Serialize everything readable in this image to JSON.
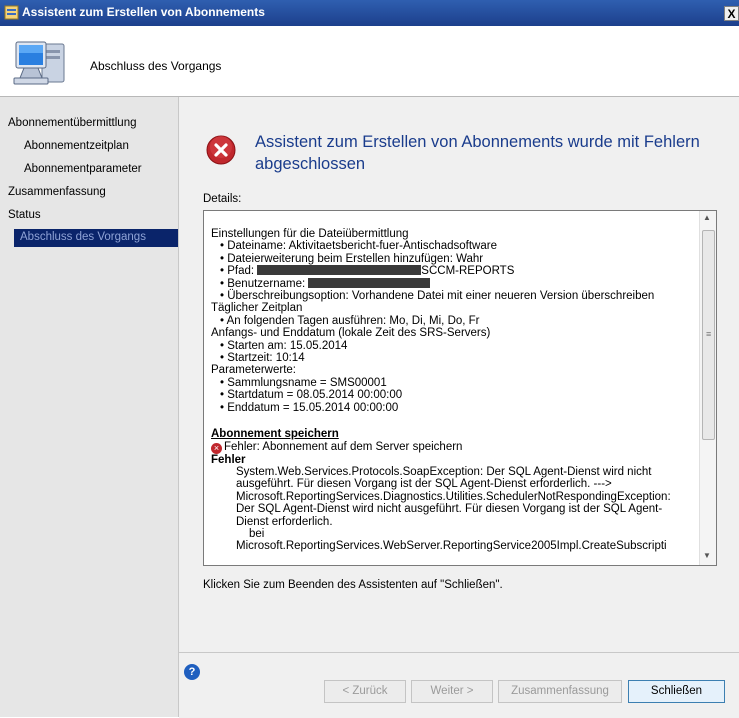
{
  "window": {
    "title": "Assistent zum Erstellen von Abonnements",
    "close_label": "X"
  },
  "header": {
    "title": "Abschluss des Vorgangs",
    "icon": "computer-monitor-icon"
  },
  "sidebar": {
    "items": [
      {
        "label": "Abonnementübermittlung"
      },
      {
        "label": "Abonnementzeitplan"
      },
      {
        "label": "Abonnementparameter"
      },
      {
        "label": "Zusammenfassung"
      },
      {
        "label": "Status"
      },
      {
        "label": "Abschluss des Vorgangs"
      }
    ],
    "selected_bg": "#0a246a"
  },
  "main": {
    "heading": "Assistent zum Erstellen von Abonnements wurde mit Fehlern abgeschlossen",
    "details_label": "Details:",
    "details": {
      "l1": "Einstellungen für die Dateiübermittlung",
      "l2": "Dateiname: Aktivitaetsbericht-fuer-Antischadsoftware",
      "l3": "Dateierweiterung beim Erstellen hinzufügen: Wahr",
      "l4_prefix": "Pfad:",
      "l4_suffix": "SCCM-REPORTS",
      "l5_prefix": "Benutzername:",
      "l6": "Überschreibungsoption: Vorhandene Datei mit einer neueren Version überschreiben",
      "l7": "Täglicher Zeitplan",
      "l8": "An folgenden Tagen ausführen: Mo, Di, Mi, Do, Fr",
      "l9": "Anfangs- und Enddatum (lokale Zeit des SRS-Servers)",
      "l10": "Starten am: 15.05.2014",
      "l11": "Startzeit: 10:14",
      "l12": "Parameterwerte:",
      "l13": "Sammlungsname = SMS00001",
      "l14": "Startdatum = 08.05.2014 00:00:00",
      "l15": "Enddatum = 15.05.2014 00:00:00",
      "section": "Abonnement speichern",
      "error_line": "Fehler: Abonnement auf dem Server speichern",
      "fehler": "Fehler",
      "exception": "System.Web.Services.Protocols.SoapException: Der SQL Agent-Dienst wird nicht ausgeführt. Für diesen Vorgang ist der SQL Agent-Dienst erforderlich. ---> Microsoft.ReportingServices.Diagnostics.Utilities.SchedulerNotRespondingException: Der SQL Agent-Dienst wird nicht ausgeführt. Für diesen Vorgang ist der SQL Agent-Dienst erforderlich.",
      "bei": "bei",
      "last": "Microsoft.ReportingServices.WebServer.ReportingService2005Impl.CreateSubscripti"
    },
    "footer_text": "Klicken Sie zum Beenden des Assistenten auf \"Schließen\"."
  },
  "buttons": {
    "back": "< Zurück",
    "next": "Weiter >",
    "summary": "Zusammenfassung",
    "close": "Schließen"
  },
  "colors": {
    "heading": "#1a3c8c",
    "error": "#c0272d",
    "titlebar": "#1c3f8c"
  }
}
